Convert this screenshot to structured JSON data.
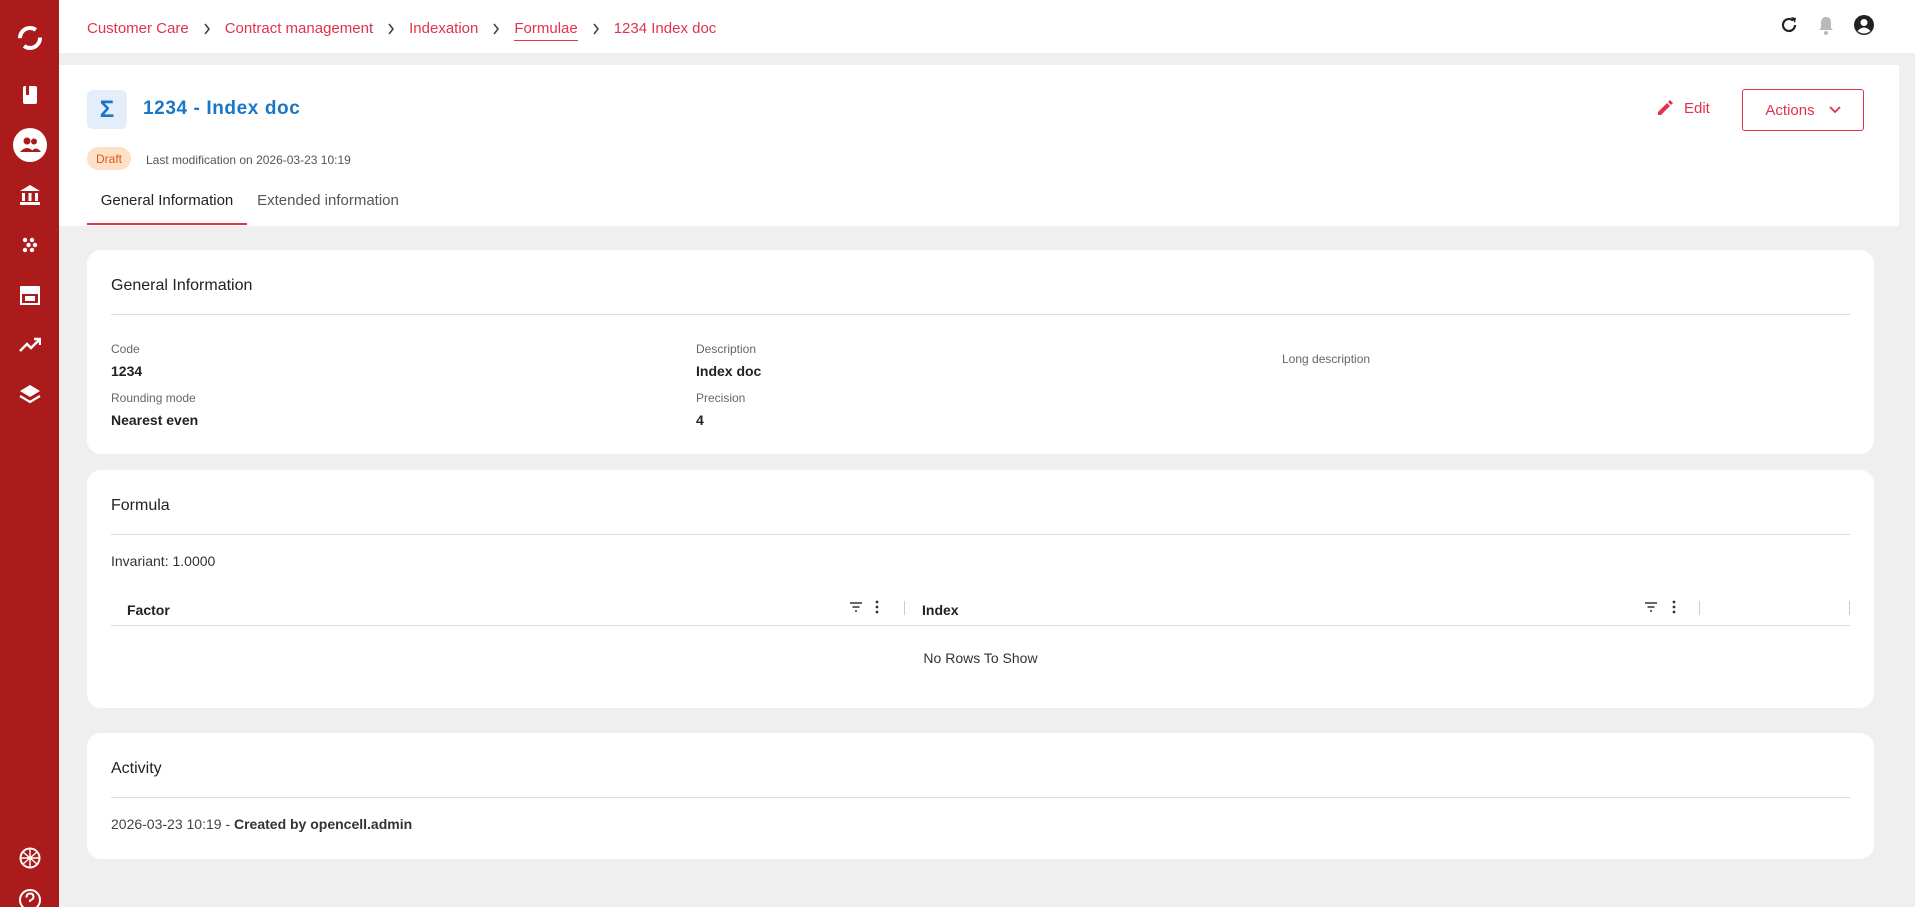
{
  "sidebar": {
    "items": [
      {
        "icon": "logo-icon"
      },
      {
        "icon": "book-icon"
      },
      {
        "icon": "customers-icon",
        "active": true
      },
      {
        "icon": "bank-icon"
      },
      {
        "icon": "grid-dots-icon"
      },
      {
        "icon": "store-icon"
      },
      {
        "icon": "trending-up-icon"
      },
      {
        "icon": "layers-icon"
      }
    ],
    "bottom": [
      {
        "icon": "globe-icon"
      },
      {
        "icon": "help-icon"
      }
    ]
  },
  "breadcrumb": {
    "items": [
      "Customer Care",
      "Contract management",
      "Indexation",
      "Formulae",
      "1234 Index doc"
    ]
  },
  "header": {
    "title_icon": "Σ",
    "title": "1234 - Index doc",
    "edit_label": "Edit",
    "actions_label": "Actions",
    "status_badge": "Draft",
    "last_modification": "Last modification on 2026-03-23 10:19"
  },
  "tabs": [
    {
      "label": "General Information",
      "active": true
    },
    {
      "label": "Extended information",
      "active": false
    }
  ],
  "general": {
    "title": "General Information",
    "code_label": "Code",
    "code_value": "1234",
    "description_label": "Description",
    "description_value": "Index doc",
    "long_description_label": "Long description",
    "rounding_label": "Rounding mode",
    "rounding_value": "Nearest even",
    "precision_label": "Precision",
    "precision_value": "4"
  },
  "formula": {
    "title": "Formula",
    "invariant": "Invariant: 1.0000",
    "columns": [
      "Factor",
      "Index"
    ],
    "empty_message": "No Rows To Show"
  },
  "activity": {
    "title": "Activity",
    "entries": [
      {
        "timestamp": "2026-03-23 10:19 - ",
        "text": "Created by opencell.admin"
      }
    ]
  },
  "colors": {
    "sidebar": "#ac1b1b",
    "accent": "#e0334c",
    "title_blue": "#1a76c9",
    "badge_bg": "#fde0c6",
    "badge_text": "#e2571a",
    "page_bg": "#efefef"
  }
}
